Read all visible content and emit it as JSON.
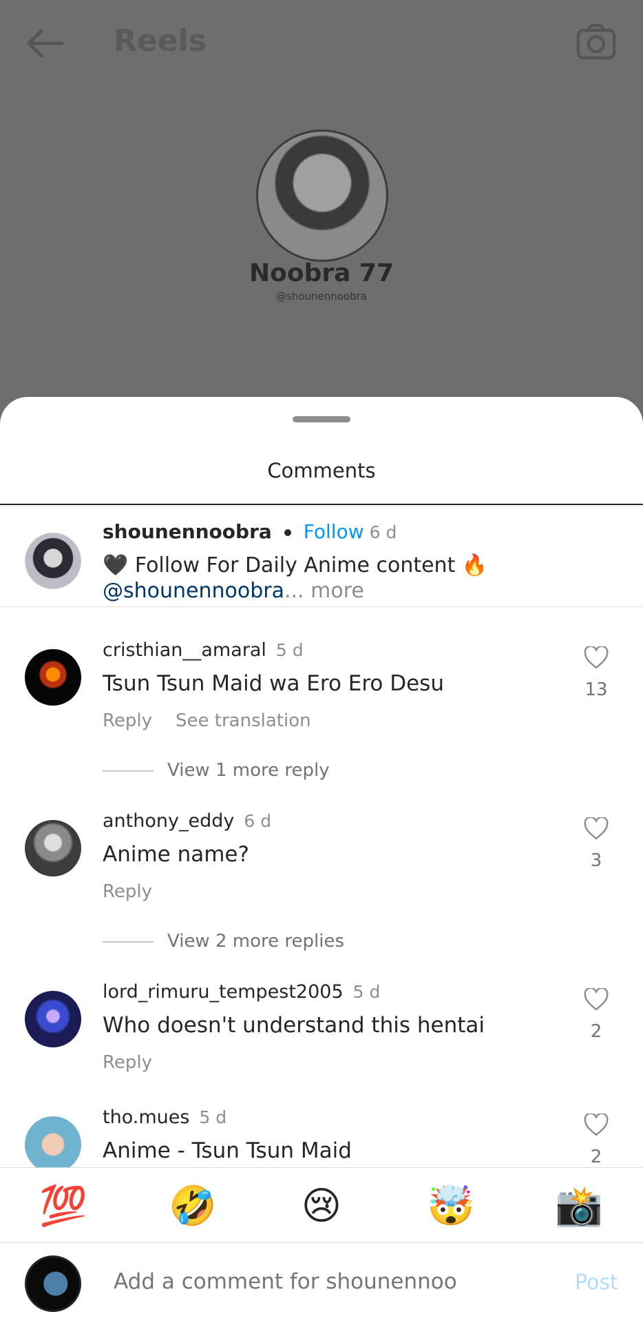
{
  "background": {
    "title": "Reels",
    "profile_name": "Noobra 77",
    "profile_handle": "@shounennoobra",
    "back_icon": "arrow-left-icon",
    "camera_icon": "camera-icon"
  },
  "sheet": {
    "title": "Comments"
  },
  "caption": {
    "username": "shounennoobra",
    "follow_label": "Follow",
    "time": "6 d",
    "text": "🖤 Follow For Daily Anime content 🔥",
    "mention": "@shounennoobra",
    "ellipsis": "...",
    "more_label": "more"
  },
  "comments": [
    {
      "username": "cristhian__amaral",
      "time": "5 d",
      "text": "Tsun Tsun Maid wa Ero Ero Desu",
      "reply_label": "Reply",
      "translate_label": "See translation",
      "likes": "13",
      "view_more": "View 1 more reply"
    },
    {
      "username": "anthony_eddy",
      "time": "6 d",
      "text": "Anime name?",
      "reply_label": "Reply",
      "likes": "3",
      "view_more": "View 2 more replies"
    },
    {
      "username": "lord_rimuru_tempest2005",
      "time": "5 d",
      "text": "Who doesn't understand this hentai",
      "reply_label": "Reply",
      "likes": "2"
    },
    {
      "username": "tho.mues",
      "time": "5 d",
      "text": "Anime - Tsun Tsun Maid",
      "likes": "2"
    }
  ],
  "emoji_bar": [
    "💯",
    "🤣",
    "😢",
    "🤯",
    "📸"
  ],
  "input": {
    "placeholder": "Add a comment for shounennoobra...",
    "post_label": "Post"
  },
  "colors": {
    "link": "#0095f6",
    "mention": "#00376b",
    "muted": "#8e8e8e",
    "post_disabled": "#b3dbff"
  }
}
